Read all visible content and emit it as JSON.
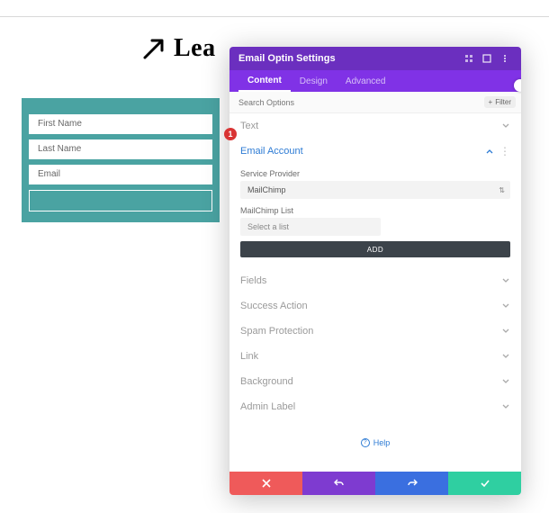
{
  "handwritten": {
    "text": "Lea"
  },
  "optin_form": {
    "fields": [
      {
        "placeholder": "First Name"
      },
      {
        "placeholder": "Last Name"
      },
      {
        "placeholder": "Email"
      }
    ]
  },
  "panel": {
    "title": "Email Optin Settings",
    "tabs": [
      "Content",
      "Design",
      "Advanced"
    ],
    "active_tab": 0,
    "search_placeholder": "Search Options",
    "filter_label": "Filter",
    "sections": {
      "text": "Text",
      "email_account": "Email Account",
      "fields": "Fields",
      "success_action": "Success Action",
      "spam_protection": "Spam Protection",
      "link": "Link",
      "background": "Background",
      "admin_label": "Admin Label"
    },
    "email_account": {
      "service_provider_label": "Service Provider",
      "service_provider_value": "MailChimp",
      "list_label": "MailChimp List",
      "list_value": "Select a list",
      "add_button": "ADD"
    },
    "help_label": "Help"
  },
  "badge": "1"
}
